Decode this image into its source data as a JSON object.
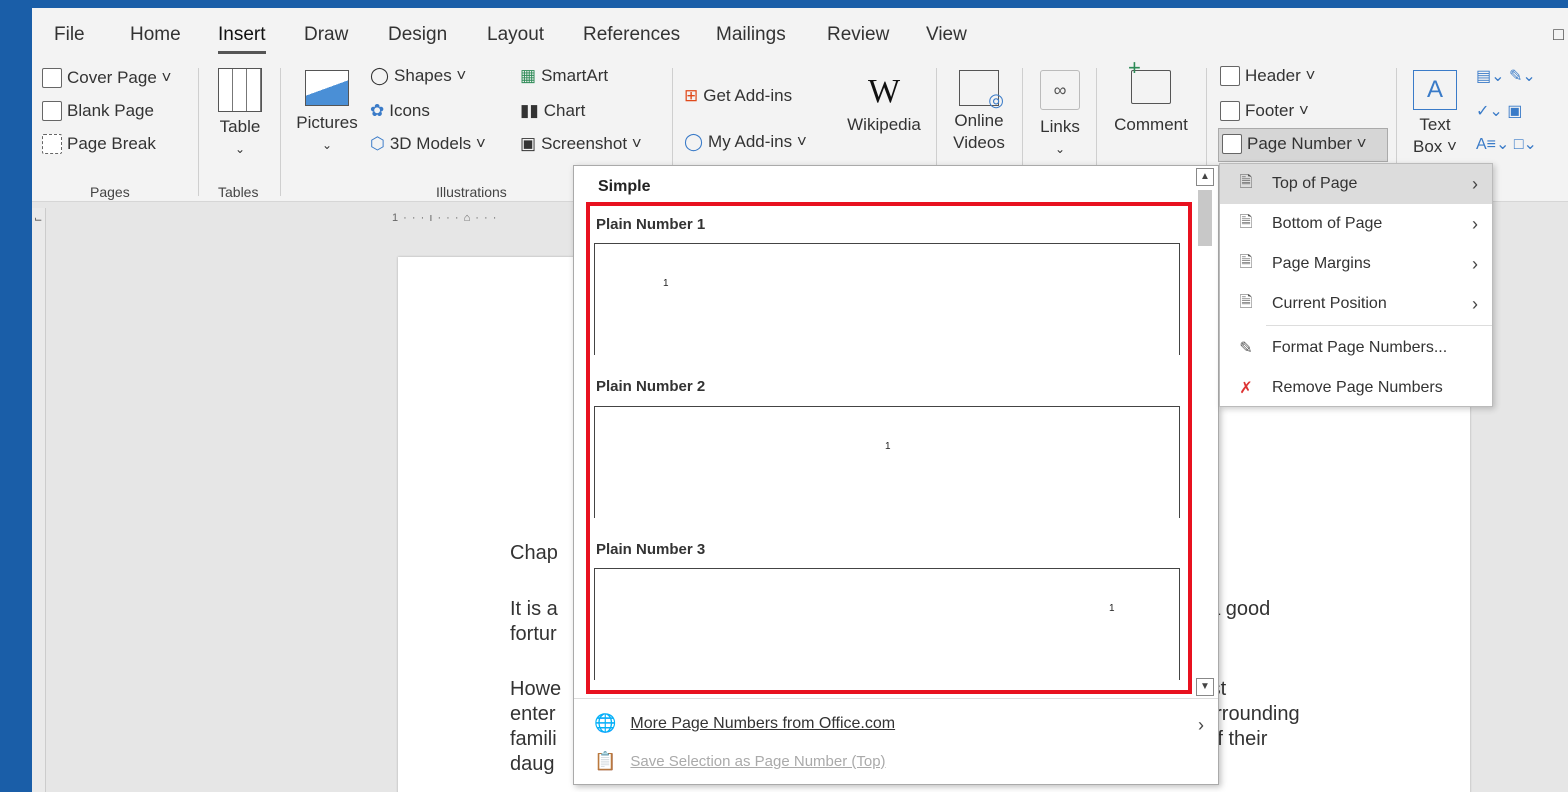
{
  "menu": {
    "tabs": [
      "File",
      "Home",
      "Insert",
      "Draw",
      "Design",
      "Layout",
      "References",
      "Mailings",
      "Review",
      "View"
    ],
    "active": "Insert"
  },
  "ribbon": {
    "pages": {
      "cover": "Cover Page ˅",
      "blank": "Blank Page",
      "break": "Page Break",
      "label": "Pages"
    },
    "tables": {
      "table": "Table",
      "label": "Tables"
    },
    "illustrations": {
      "pictures": "Pictures",
      "shapes": "Shapes ˅",
      "icons": "Icons",
      "models": "3D Models ˅",
      "smartart": "SmartArt",
      "chart": "Chart",
      "screenshot": "Screenshot ˅",
      "label": "Illustrations"
    },
    "addins": {
      "get": "Get Add-ins",
      "my": "My Add-ins ˅",
      "wikipedia": "Wikipedia"
    },
    "media": {
      "online": "Online",
      "videos": "Videos"
    },
    "links": "Links",
    "comment": "Comment",
    "hf": {
      "header": "Header ˅",
      "footer": "Footer ˅",
      "pagenumber": "Page Number ˅"
    },
    "text": {
      "textbox": "Text",
      "box": "Box ˅"
    }
  },
  "document": {
    "line1": "Chap",
    "line2": "It is a\nfortur",
    "line3": "Howe\nenter\nfamili\ndaug",
    "right1": "f a good",
    "right2": " first\nsurrounding\nr of their"
  },
  "gallery": {
    "section": "Simple",
    "items": [
      {
        "title": "Plain Number 1",
        "num": "1"
      },
      {
        "title": "Plain Number 2",
        "num": "1"
      },
      {
        "title": "Plain Number 3",
        "num": "1"
      }
    ],
    "more": "More Page Numbers from Office.com",
    "save": "Save Selection as Page Number (Top)"
  },
  "submenu": {
    "items": [
      {
        "label": "Top of Page",
        "arrow": true
      },
      {
        "label": "Bottom of Page",
        "arrow": true
      },
      {
        "label": "Page Margins",
        "arrow": true
      },
      {
        "label": "Current Position",
        "arrow": true
      },
      {
        "label": "Format Page Numbers...",
        "arrow": false
      },
      {
        "label": "Remove Page Numbers",
        "arrow": false
      }
    ]
  },
  "colors": {
    "highlight": "#e8111f",
    "frame": "#1a5ea8"
  }
}
